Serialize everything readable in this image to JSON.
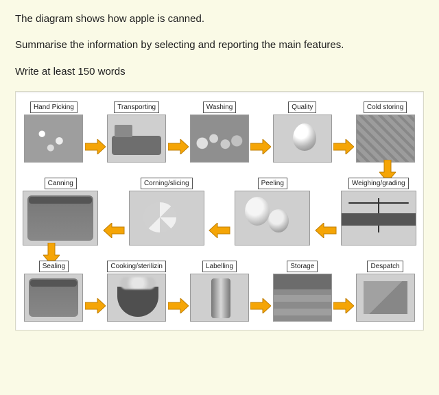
{
  "intro": {
    "line1": "The diagram shows how apple is canned.",
    "line2": "Summarise the information by selecting and reporting the main features.",
    "line3": "Write at least 150 words"
  },
  "arrow_color": "#f5a506",
  "chart_data": {
    "type": "process-diagram",
    "title": "Apple canning process",
    "flow": "serpentine (left→right, down, right→left, down, left→right)",
    "rows": 3,
    "steps": [
      {
        "order": 1,
        "row": 1,
        "label": "Hand Picking",
        "image": "hand picking apples from tree"
      },
      {
        "order": 2,
        "row": 1,
        "label": "Transporting",
        "image": "truck loaded with apples"
      },
      {
        "order": 3,
        "row": 1,
        "label": "Washing",
        "image": "pile of washed apples"
      },
      {
        "order": 4,
        "row": 1,
        "label": "Quality",
        "image": "single apple being inspected"
      },
      {
        "order": 5,
        "row": 1,
        "label": "Cold storing",
        "image": "apples in cold storage crates"
      },
      {
        "order": 6,
        "row": 2,
        "label": "Weighing/grading",
        "image": "balance scale with apples"
      },
      {
        "order": 7,
        "row": 2,
        "label": "Peeling",
        "image": "peeled apples"
      },
      {
        "order": 8,
        "row": 2,
        "label": "Corning/slicing",
        "image": "apple slices"
      },
      {
        "order": 9,
        "row": 2,
        "label": "Canning",
        "image": "jars of canned apple"
      },
      {
        "order": 10,
        "row": 3,
        "label": "Sealing",
        "image": "sealed jars"
      },
      {
        "order": 11,
        "row": 3,
        "label": "Cooking/sterilizin",
        "image": "pot with steam"
      },
      {
        "order": 12,
        "row": 3,
        "label": "Labelling",
        "image": "labelled cans"
      },
      {
        "order": 13,
        "row": 3,
        "label": "Storage",
        "image": "warehouse shelves with boxes"
      },
      {
        "order": 14,
        "row": 3,
        "label": "Despatch",
        "image": "cardboard boxes for shipment"
      }
    ]
  }
}
